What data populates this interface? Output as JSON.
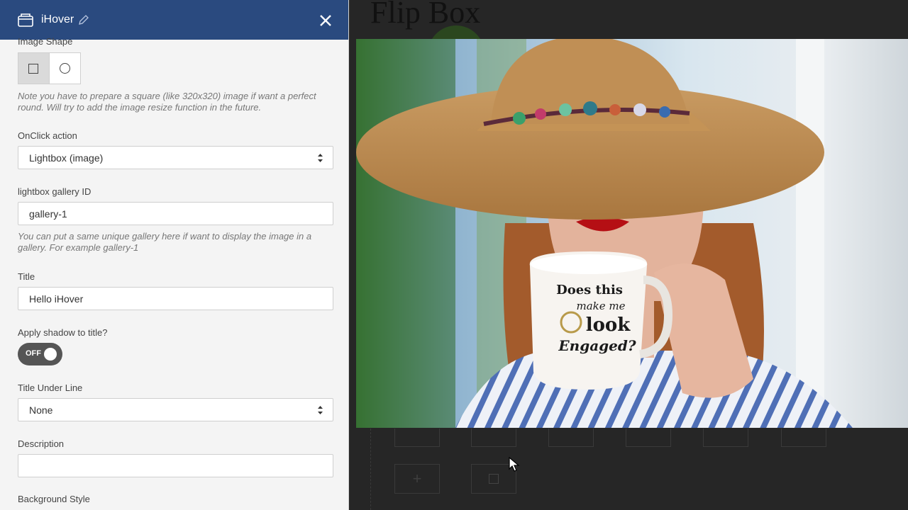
{
  "panel": {
    "title": "iHover",
    "image_shape_label": "Image Shape",
    "image_shape_options": [
      "square",
      "round"
    ],
    "image_shape_selected": "square",
    "image_shape_note": "Note you have to prepare a square (like 320x320) image if want a perfect round. Will try to add the image resize function in the future.",
    "onclick_label": "OnClick action",
    "onclick_value": "Lightbox (image)",
    "gallery_label": "lightbox gallery ID",
    "gallery_value": "gallery-1",
    "gallery_note": "You can put a same unique gallery here if want to display the image in a gallery. For example gallery-1",
    "title_label": "Title",
    "title_value": "Hello iHover",
    "shadow_label": "Apply shadow to title?",
    "shadow_toggle": "OFF",
    "underline_label": "Title Under Line",
    "underline_value": "None",
    "description_label": "Description",
    "description_value": "",
    "background_label": "Background Style"
  },
  "content": {
    "heading": "Flip Box",
    "photo_subject": "woman in straw hat holding mug",
    "mug_text": "Does this make me look Engaged?",
    "add_icon": "+"
  },
  "icons": {
    "header": "box-icon",
    "edit": "pencil-icon",
    "close": "close-icon",
    "select": "select-arrows-icon",
    "cursor": "arrow-cursor-icon"
  },
  "colors": {
    "header_bg": "#2a4a7f",
    "panel_bg": "#f4f4f4",
    "canvas_bg": "#262626",
    "toggle_off": "#555555"
  }
}
